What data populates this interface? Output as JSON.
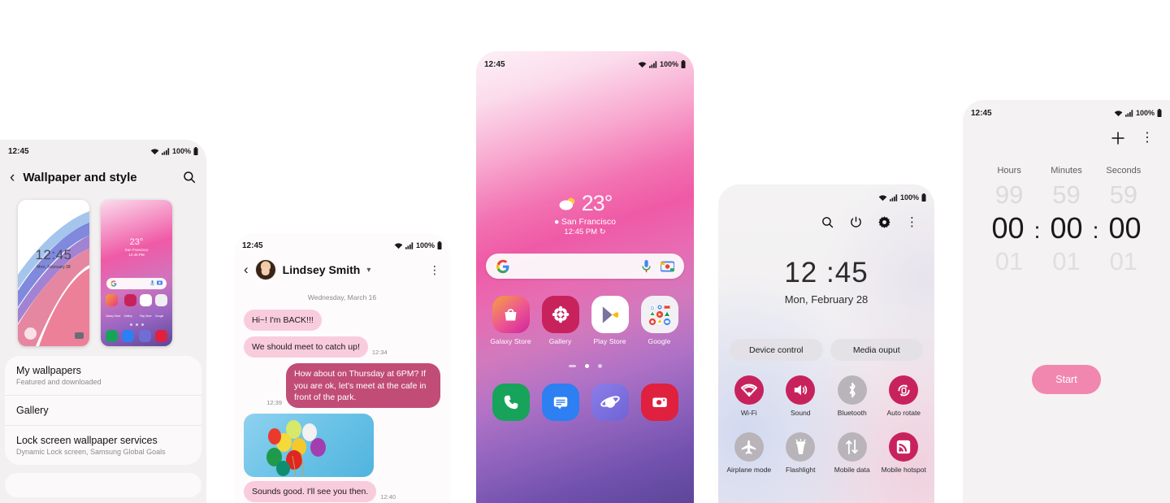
{
  "status_bar": {
    "time": "12:45",
    "battery": "100%",
    "wifi_icon": "wifi-icon",
    "signal_icon": "signal-icon",
    "battery_icon": "battery-icon"
  },
  "panel_wallpaper": {
    "title": "Wallpaper and style",
    "back_icon": "back-arrow-icon",
    "search_icon": "search-icon",
    "preview_lock": {
      "clock": "12:45",
      "date": "Mon, February 28",
      "camera_icon": "camera-icon"
    },
    "preview_home": {
      "temp": "23°",
      "location": "San Francisco",
      "time": "12:45 PM",
      "apps": [
        "Galaxy Store",
        "Gallery",
        "Play Store",
        "Google"
      ]
    },
    "rows": [
      {
        "title": "My wallpapers",
        "subtitle": "Featured and downloaded"
      },
      {
        "title": "Gallery",
        "subtitle": ""
      },
      {
        "title": "Lock screen wallpaper services",
        "subtitle": "Dynamic Lock screen, Samsung Global Goals"
      }
    ]
  },
  "panel_messages": {
    "contact": "Lindsey Smith",
    "back_icon": "back-arrow-icon",
    "avatar_icon": "avatar",
    "chevron_icon": "chevron-down-icon",
    "more_icon": "kebab-menu-icon",
    "day_divider": "Wednesday, March 16",
    "messages": [
      {
        "side": "them",
        "text": "Hi~! I'm BACK!!!",
        "time": ""
      },
      {
        "side": "them",
        "text": "We should meet to catch up!",
        "time": "12:34"
      },
      {
        "side": "me",
        "text": "How about on Thursday at 6PM? If you are ok, let's meet at the cafe in front of the park.",
        "time": "12:39"
      },
      {
        "side": "them",
        "type": "image",
        "text": "balloons-photo",
        "time": ""
      },
      {
        "side": "them",
        "text": "Sounds good. I'll see you then.",
        "time": "12:40"
      }
    ]
  },
  "panel_home": {
    "weather": {
      "temp": "23°",
      "location": "San Francisco",
      "time": "12:45 PM",
      "icon": "partly-cloudy-icon",
      "pin_icon": "location-pin-icon",
      "refresh_icon": "refresh-icon"
    },
    "search": {
      "logo": "google-g-icon",
      "mic_icon": "microphone-icon",
      "lens_icon": "google-lens-icon"
    },
    "apps": [
      {
        "label": "Galaxy Store",
        "icon": "galaxy-store-icon"
      },
      {
        "label": "Gallery",
        "icon": "gallery-icon"
      },
      {
        "label": "Play Store",
        "icon": "play-store-icon"
      },
      {
        "label": "Google",
        "icon": "google-folder-icon"
      }
    ],
    "page_indicator": {
      "count": 3,
      "active": 1
    },
    "dock": [
      {
        "label": "Phone",
        "icon": "phone-icon"
      },
      {
        "label": "Messages",
        "icon": "messages-icon"
      },
      {
        "label": "Internet",
        "icon": "samsung-internet-icon"
      },
      {
        "label": "Camera",
        "icon": "camera-icon"
      }
    ]
  },
  "panel_quick": {
    "tools": [
      {
        "icon": "search-icon",
        "name": "search"
      },
      {
        "icon": "power-icon",
        "name": "power"
      },
      {
        "icon": "gear-icon",
        "name": "settings"
      },
      {
        "icon": "kebab-menu-icon",
        "name": "more"
      }
    ],
    "clock": "12 :45",
    "date": "Mon, February 28",
    "pills": [
      "Device control",
      "Media ouput"
    ],
    "tiles_row1": [
      {
        "label": "Wi-Fi",
        "icon": "wifi-icon",
        "on": true
      },
      {
        "label": "Sound",
        "icon": "speaker-icon",
        "on": true
      },
      {
        "label": "Bluetooth",
        "icon": "bluetooth-icon",
        "on": false
      },
      {
        "label": "Auto rotate",
        "icon": "auto-rotate-icon",
        "on": true
      }
    ],
    "tiles_row2": [
      {
        "label": "Airplane mode",
        "icon": "airplane-icon",
        "on": false
      },
      {
        "label": "Flashlight",
        "icon": "flashlight-icon",
        "on": false
      },
      {
        "label": "Mobile data",
        "icon": "data-transfer-icon",
        "on": false
      },
      {
        "label": "Mobile hotspot",
        "icon": "hotspot-icon",
        "on": true
      }
    ]
  },
  "panel_timer": {
    "add_icon": "plus-icon",
    "more_icon": "kebab-menu-icon",
    "headers": [
      "Hours",
      "Minutes",
      "Seconds"
    ],
    "above": [
      "99",
      "59",
      "59"
    ],
    "current": [
      "00",
      "00",
      "00"
    ],
    "below": [
      "01",
      "01",
      "01"
    ],
    "separator": ":",
    "start_label": "Start"
  },
  "colors": {
    "accent_pink": "#c14d77",
    "bubble_them": "#f9ccdd",
    "tile_on": "#c8225c",
    "start_button": "#f187ae"
  }
}
